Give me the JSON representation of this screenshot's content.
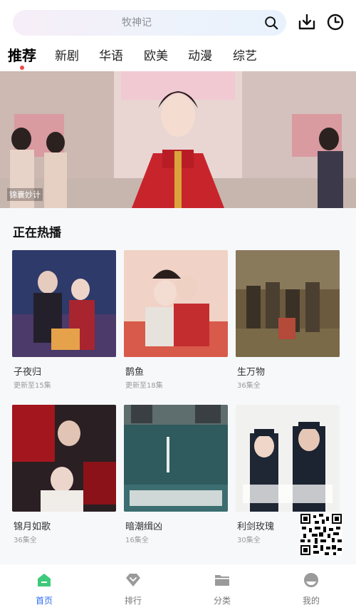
{
  "search": {
    "placeholder": "牧神记"
  },
  "icons": {
    "search": "search-icon",
    "download": "download-icon",
    "history": "clock-icon"
  },
  "tabs": [
    {
      "label": "推荐",
      "active": true
    },
    {
      "label": "新剧"
    },
    {
      "label": "华语"
    },
    {
      "label": "欧美"
    },
    {
      "label": "动漫"
    },
    {
      "label": "综艺"
    }
  ],
  "banner": {
    "caption": "锦囊妙计"
  },
  "section": {
    "title": "正在热播"
  },
  "cards": [
    {
      "title": "子夜归",
      "sub": "更新至15集"
    },
    {
      "title": "鹊鱼",
      "sub": "更新至18集"
    },
    {
      "title": "生万物",
      "sub": "36集全"
    },
    {
      "title": "锦月如歌",
      "sub": "36集全"
    },
    {
      "title": "暗潮缉凶",
      "sub": "16集全"
    },
    {
      "title": "利剑玫瑰",
      "sub": "30集全"
    }
  ],
  "bottom_nav": [
    {
      "label": "首页",
      "active": true,
      "icon": "home-icon"
    },
    {
      "label": "排行",
      "icon": "diamond-icon"
    },
    {
      "label": "分类",
      "icon": "folder-icon"
    },
    {
      "label": "我的",
      "icon": "profile-icon"
    }
  ],
  "colors": {
    "accent": "#2c6cf0",
    "home_icon": "#3ec97b",
    "tab_dot": "#f04a4a",
    "section_bg": "#f7f8fa"
  }
}
